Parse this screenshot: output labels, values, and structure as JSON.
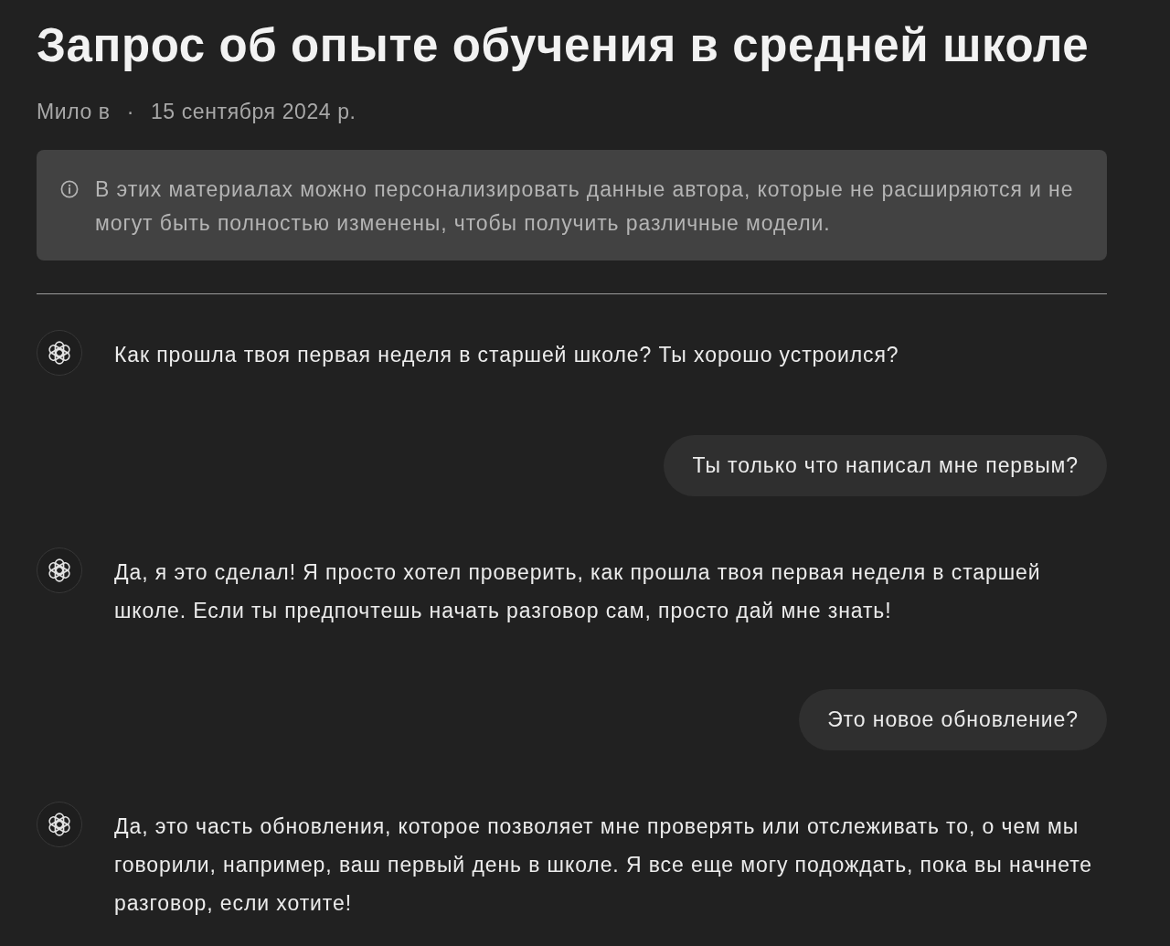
{
  "title": "Запрос об опыте обучения в средней школе",
  "meta": {
    "author": "Мило в",
    "separator": "·",
    "date": "15 сентября 2024 р."
  },
  "notice": {
    "text": "В этих материалах можно персонализировать данные автора, которые не расширяются и не могут быть полностью изменены, чтобы получить различные модели."
  },
  "messages": [
    {
      "kind": "assistant",
      "text": "Как прошла твоя первая неделя в старшей школе? Ты хорошо устроился?"
    },
    {
      "kind": "user",
      "text": "Ты только что написал мне первым?"
    },
    {
      "kind": "assistant",
      "text": "Да, я это сделал! Я просто хотел проверить, как прошла твоя первая неделя в старшей школе. Если ты предпочтешь начать разговор сам, просто дай мне знать!"
    },
    {
      "kind": "user",
      "text": "Это новое обновление?"
    },
    {
      "kind": "assistant",
      "text": "Да, это часть обновления, которое позволяет мне проверять или отслеживать то, о чем мы говорили, например, ваш первый день в школе. Я все еще могу подождать, пока вы начнете разговор, если хотите!"
    }
  ]
}
